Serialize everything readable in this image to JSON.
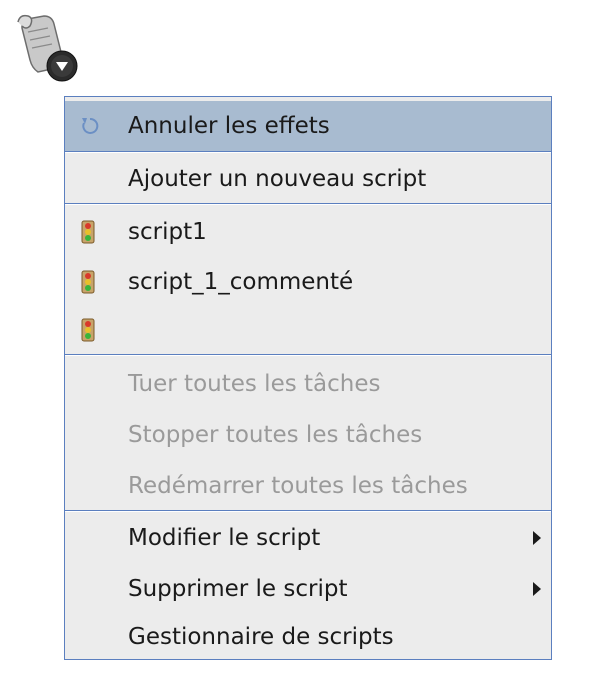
{
  "toolbar": {
    "icon": "script-scroll-icon"
  },
  "menu": {
    "undo": {
      "label": "Annuler les effets",
      "icon": "undo-icon"
    },
    "add_script": {
      "label": "Ajouter un nouveau script"
    },
    "scripts": [
      {
        "label": "script1",
        "icon": "traffic-light-icon"
      },
      {
        "label": "script_1_commenté",
        "icon": "traffic-light-icon"
      },
      {
        "label": "",
        "icon": "traffic-light-icon"
      }
    ],
    "task_actions": [
      {
        "label": "Tuer toutes les tâches",
        "enabled": false
      },
      {
        "label": "Stopper toutes les tâches",
        "enabled": false
      },
      {
        "label": "Redémarrer toutes les tâches",
        "enabled": false
      }
    ],
    "edit_script": {
      "label": "Modifier le script"
    },
    "delete_script": {
      "label": "Supprimer le script"
    },
    "script_manager": {
      "label": "Gestionnaire de scripts"
    }
  },
  "colors": {
    "menu_background": "#ececec",
    "highlight": "#a8bbd0",
    "border": "#5b7fbf",
    "disabled_text": "#9a9a9a"
  }
}
